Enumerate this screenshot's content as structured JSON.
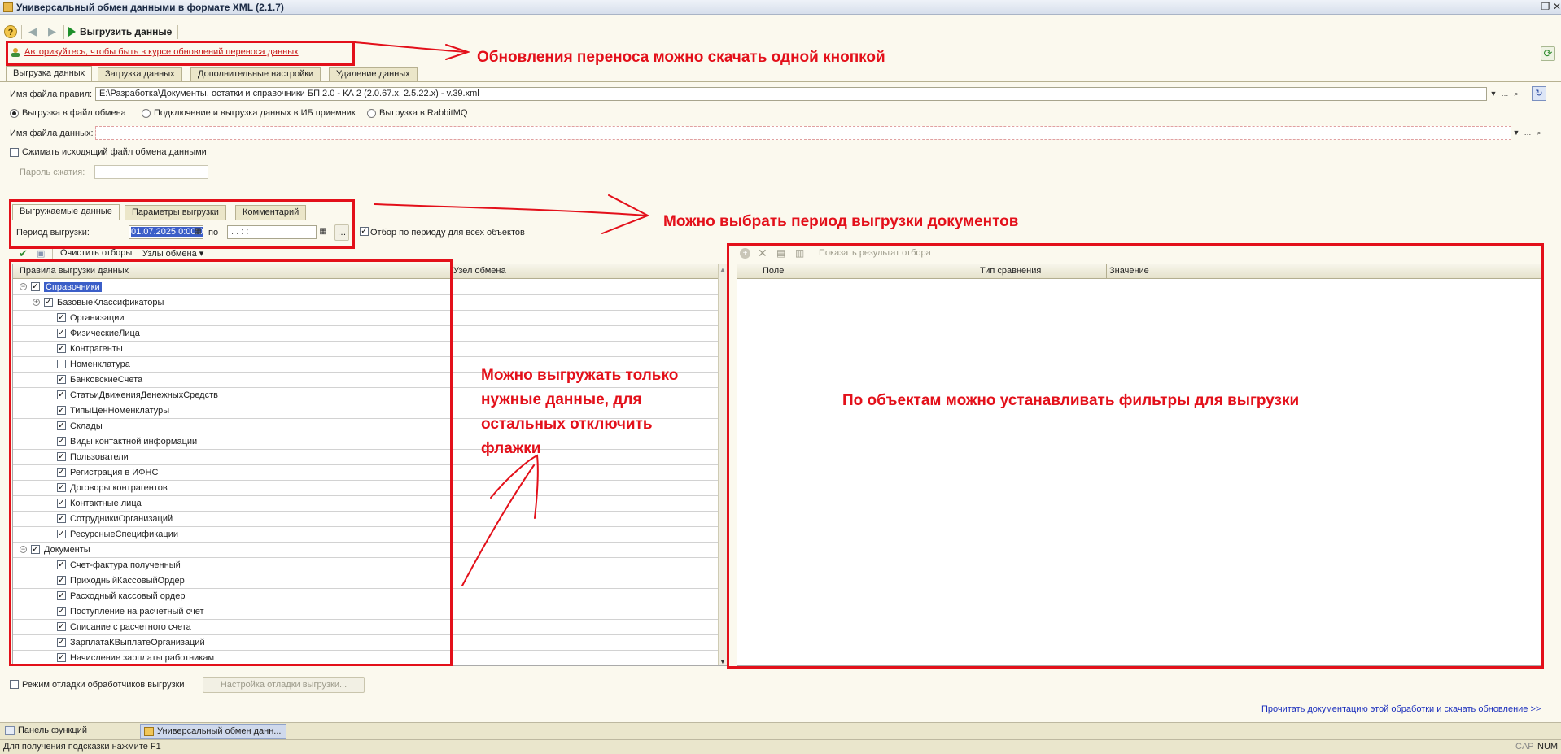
{
  "window": {
    "title": "Универсальный обмен данными в формате XML (2.1.7)",
    "controls": [
      "_",
      "❐",
      "✕"
    ]
  },
  "toolbar": {
    "icons": [
      "help-icon",
      "back-icon",
      "forward-icon"
    ],
    "run_label": "Выгрузить данные"
  },
  "auth_link": "Авторизуйтесь, чтобы быть в курсе обновлений переноса данных",
  "main_tabs": [
    {
      "label": "Выгрузка данных",
      "active": true
    },
    {
      "label": "Загрузка данных",
      "active": false
    },
    {
      "label": "Дополнительные настройки",
      "active": false
    },
    {
      "label": "Удаление данных",
      "active": false
    }
  ],
  "rules_file": {
    "label": "Имя файла правил:",
    "value": "E:\\Разработка\\Документы, остатки и справочники БП 2.0 - КА 2 (2.0.67.x, 2.5.22.x) - v.39.xml"
  },
  "export_mode": {
    "options": [
      {
        "label": "Выгрузка в файл обмена",
        "selected": true
      },
      {
        "label": "Подключение и выгрузка данных в ИБ приемник",
        "selected": false
      },
      {
        "label": "Выгрузка в RabbitMQ",
        "selected": false
      }
    ]
  },
  "data_file": {
    "label": "Имя файла данных:",
    "value": ""
  },
  "compress": {
    "label": "Сжимать исходящий файл обмена данными",
    "checked": false
  },
  "password": {
    "label": "Пароль сжатия:",
    "value": ""
  },
  "inner_tabs": [
    {
      "label": "Выгружаемые данные",
      "active": true
    },
    {
      "label": "Параметры выгрузки",
      "active": false
    },
    {
      "label": "Комментарий",
      "active": false
    }
  ],
  "period": {
    "label": "Период выгрузки:",
    "from": "01.07.2025  0:00:00",
    "to_label": "по",
    "to": " .  .      :  :",
    "filter_all_label": "Отбор по периоду для всех объектов",
    "filter_all_checked": true
  },
  "left_toolbar": {
    "clear_label": "Очистить отборы",
    "nodes_label": "Узлы обмена"
  },
  "rules_table": {
    "headers": [
      "Правила выгрузки данных",
      "Узел обмена"
    ],
    "rows": [
      {
        "level": 0,
        "label": "Справочники",
        "checked": true,
        "expander": "⊖",
        "selected": true
      },
      {
        "level": 1,
        "label": "БазовыеКлассификаторы",
        "checked": true,
        "expander": "⊕"
      },
      {
        "level": 2,
        "label": "Организации",
        "checked": true
      },
      {
        "level": 2,
        "label": "ФизическиеЛица",
        "checked": true
      },
      {
        "level": 2,
        "label": "Контрагенты",
        "checked": true
      },
      {
        "level": 2,
        "label": "Номенклатура",
        "checked": false
      },
      {
        "level": 2,
        "label": "БанковскиеСчета",
        "checked": true
      },
      {
        "level": 2,
        "label": "СтатьиДвиженияДенежныхСредств",
        "checked": true
      },
      {
        "level": 2,
        "label": "ТипыЦенНоменклатуры",
        "checked": true
      },
      {
        "level": 2,
        "label": "Склады",
        "checked": true
      },
      {
        "level": 2,
        "label": "Виды контактной информации",
        "checked": true
      },
      {
        "level": 2,
        "label": "Пользователи",
        "checked": true
      },
      {
        "level": 2,
        "label": "Регистрация в ИФНС",
        "checked": true
      },
      {
        "level": 2,
        "label": "Договоры контрагентов",
        "checked": true
      },
      {
        "level": 2,
        "label": "Контактные лица",
        "checked": true
      },
      {
        "level": 2,
        "label": "СотрудникиОрганизаций",
        "checked": true
      },
      {
        "level": 2,
        "label": "РесурсныеСпецификации",
        "checked": true
      },
      {
        "level": 0,
        "label": "Документы",
        "checked": true,
        "expander": "⊖"
      },
      {
        "level": 2,
        "label": "Счет-фактура полученный",
        "checked": true
      },
      {
        "level": 2,
        "label": "ПриходныйКассовыйОрдер",
        "checked": true
      },
      {
        "level": 2,
        "label": "Расходный кассовый ордер",
        "checked": true
      },
      {
        "level": 2,
        "label": "Поступление на расчетный счет",
        "checked": true
      },
      {
        "level": 2,
        "label": "Списание с расчетного счета",
        "checked": true
      },
      {
        "level": 2,
        "label": "ЗарплатаКВыплатеОрганизаций",
        "checked": true
      },
      {
        "level": 2,
        "label": "Начисление зарплаты работникам",
        "checked": true
      }
    ]
  },
  "filter_panel": {
    "show_result_label": "Показать результат отбора",
    "headers": [
      "Поле",
      "Тип сравнения",
      "Значение"
    ]
  },
  "debug": {
    "checkbox_label": "Режим отладки обработчиков выгрузки",
    "checked": false,
    "button_label": "Настройка отладки выгрузки..."
  },
  "doc_link": "Прочитать документацию этой обработки и скачать обновление >>",
  "annotations": {
    "updates": "Обновления переноса можно скачать одной кнопкой",
    "period": "Можно выбрать период выгрузки документов",
    "only_needed": [
      "Можно выгружать только",
      "нужные данные, для",
      "остальных отключить",
      "флажки"
    ],
    "filters": "По объектам можно устанавливать фильтры для выгрузки"
  },
  "taskbar": [
    {
      "label": "Панель функций",
      "active": false
    },
    {
      "label": "Универсальный обмен данн...",
      "active": true
    }
  ],
  "status": {
    "hint": "Для получения подсказки нажмите F1",
    "indicators": [
      "CAP",
      "NUM"
    ]
  },
  "colors": {
    "annotation": "#e3101a",
    "accent": "#3b5ec8"
  }
}
